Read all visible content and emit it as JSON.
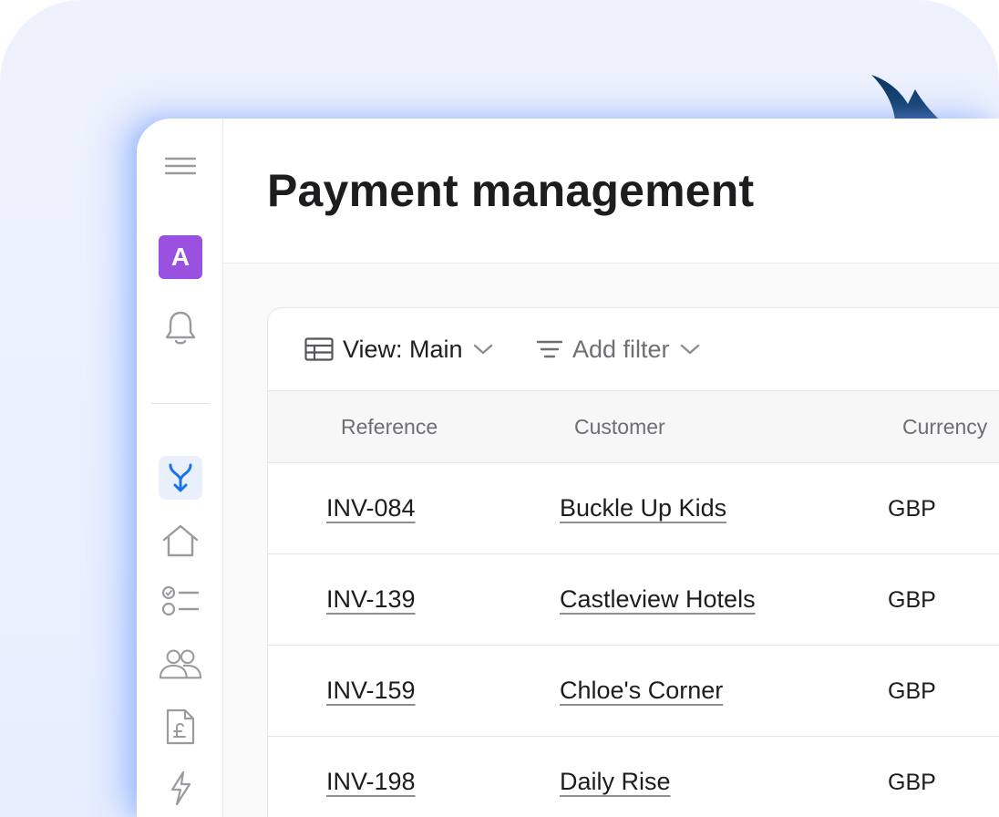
{
  "header": {
    "title": "Payment management"
  },
  "sidebar": {
    "avatar_letter": "A",
    "items": [
      {
        "icon": "menu-icon"
      },
      {
        "icon": "bell-icon"
      },
      {
        "icon": "merge-arrow-icon",
        "active": true
      },
      {
        "icon": "home-icon"
      },
      {
        "icon": "checklist-icon"
      },
      {
        "icon": "users-icon"
      },
      {
        "icon": "invoice-pound-icon"
      },
      {
        "icon": "lightning-icon"
      }
    ]
  },
  "toolbar": {
    "view_label": "View: Main",
    "filter_label": "Add filter"
  },
  "table": {
    "columns": [
      "Reference",
      "Customer",
      "Currency"
    ],
    "rows": [
      {
        "reference": "INV-084",
        "customer": "Buckle Up Kids",
        "currency": "GBP"
      },
      {
        "reference": "INV-139",
        "customer": "Castleview Hotels",
        "currency": "GBP"
      },
      {
        "reference": "INV-159",
        "customer": "Chloe's Corner",
        "currency": "GBP"
      },
      {
        "reference": "INV-198",
        "customer": "Daily Rise",
        "currency": "GBP"
      }
    ]
  },
  "colors": {
    "accent": "#1a73e8",
    "avatar": "#9a51e0",
    "logo": "#0d3b66",
    "backdrop": "#eef2fd"
  }
}
